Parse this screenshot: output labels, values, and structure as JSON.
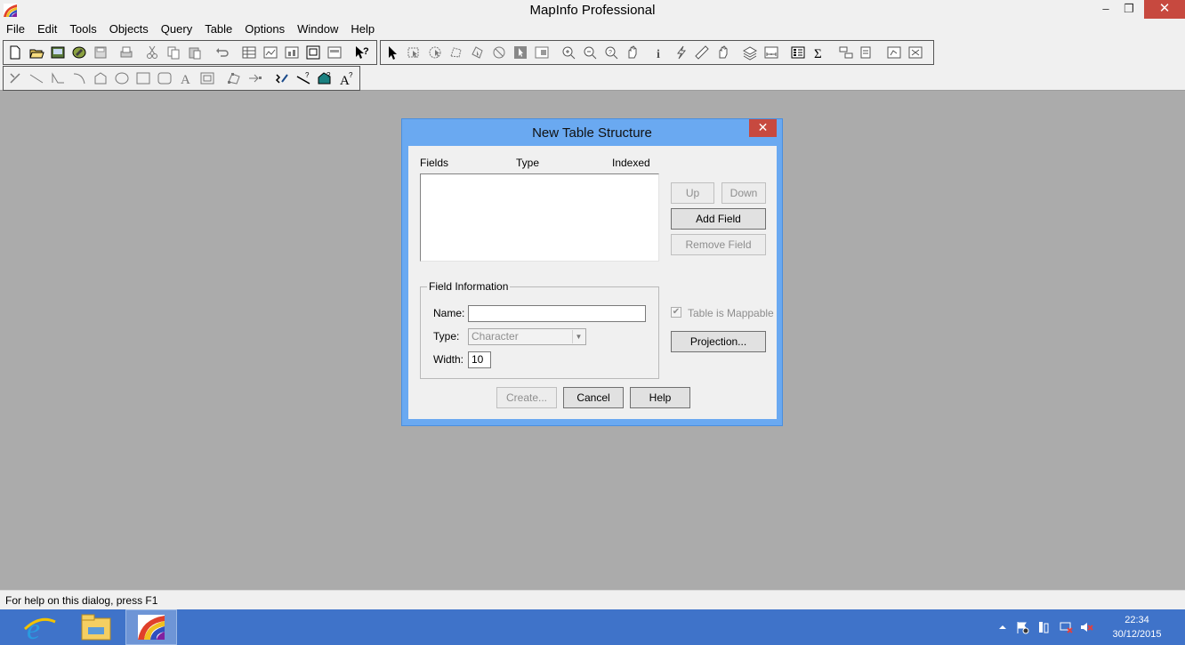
{
  "window": {
    "title": "MapInfo Professional",
    "minimize_glyph": "–",
    "restore_glyph": "❐",
    "close_glyph": "✕"
  },
  "menu": [
    "File",
    "Edit",
    "Tools",
    "Objects",
    "Query",
    "Table",
    "Options",
    "Window",
    "Help"
  ],
  "dialog": {
    "title": "New Table Structure",
    "close_glyph": "✕",
    "fields_header": "Fields",
    "type_header": "Type",
    "indexed_header": "Indexed",
    "up_label": "Up",
    "down_label": "Down",
    "add_field_label": "Add Field",
    "remove_field_label": "Remove Field",
    "field_info_caption": "Field Information",
    "name_label": "Name:",
    "name_value": "",
    "type_label": "Type:",
    "type_value": "Character",
    "width_label": "Width:",
    "width_value": "10",
    "mappable_label": "Table is Mappable",
    "mappable_checked": true,
    "projection_label": "Projection...",
    "create_label": "Create...",
    "cancel_label": "Cancel",
    "help_label": "Help"
  },
  "status": {
    "text": "For help on this dialog, press F1"
  },
  "taskbar": {
    "time": "22:34",
    "date": "30/12/2015"
  },
  "colors": {
    "dialog_frame": "#6aa9f1",
    "close_red": "#c7493f",
    "taskbar_blue": "#3f73c9",
    "workspace_gray": "#ababab"
  }
}
